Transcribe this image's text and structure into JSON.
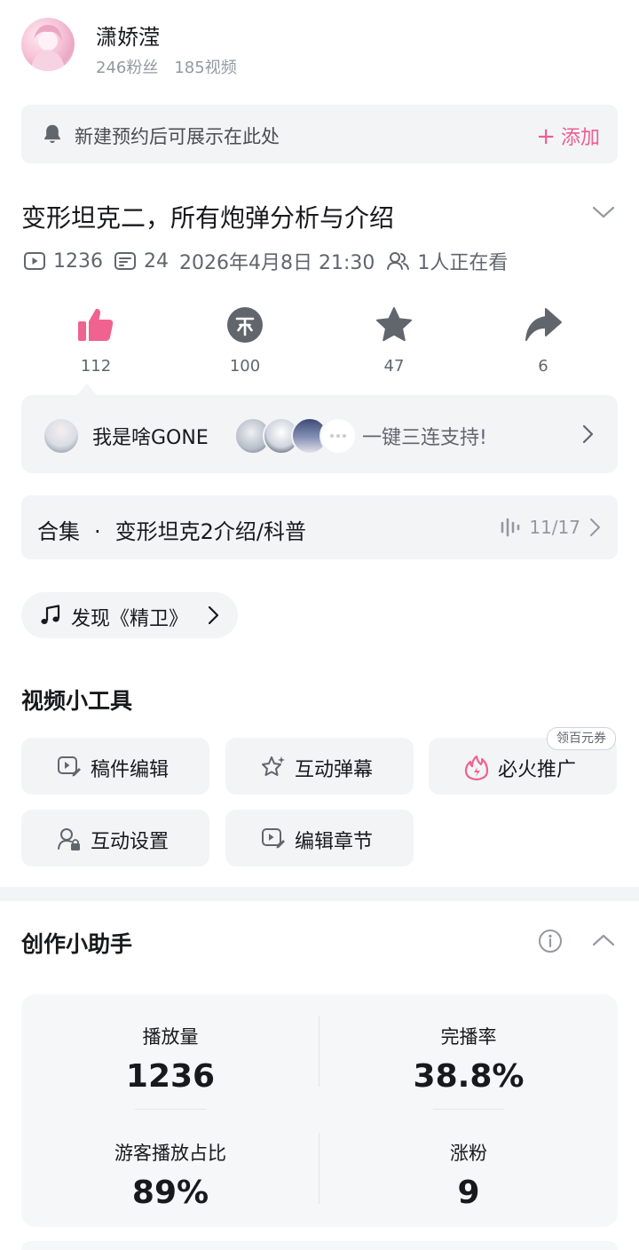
{
  "user": {
    "name": "潇娇滢",
    "fans": "246粉丝",
    "videos": "185视频"
  },
  "reserve": {
    "icon": "bell-icon",
    "text": "新建预约后可展示在此处",
    "add_label": "添加",
    "accent": "#ee5d8f"
  },
  "video": {
    "title": "变形坦克二，所有炮弹分析与介绍",
    "plays": "1236",
    "danmaku": "24",
    "datetime": "2026年4月8日 21:30",
    "watching": "1人正在看"
  },
  "actions": [
    {
      "name": "like",
      "icon": "thumbs-up-icon",
      "count": "112",
      "color": "#f0628f"
    },
    {
      "name": "coin",
      "icon": "coin-icon",
      "count": "100",
      "color": "#61666d"
    },
    {
      "name": "favorite",
      "icon": "star-icon",
      "count": "47",
      "color": "#61666d"
    },
    {
      "name": "share",
      "icon": "share-icon",
      "count": "6",
      "color": "#61666d"
    }
  ],
  "triple": {
    "username": "我是啥GONE",
    "text": "一键三连支持!"
  },
  "collection": {
    "label": "合集",
    "separator": "·",
    "name": "变形坦克2介绍/科普",
    "progress": "11/17"
  },
  "music": {
    "text": "发现《精卫》"
  },
  "tools": {
    "title": "视频小工具",
    "badge": "领百元券",
    "items": [
      {
        "label": "稿件编辑",
        "icon": "video-edit-icon"
      },
      {
        "label": "互动弹幕",
        "icon": "star-sparkle-icon"
      },
      {
        "label": "必火推广",
        "icon": "fire-icon"
      },
      {
        "label": "互动设置",
        "icon": "user-lock-icon"
      },
      {
        "label": "编辑章节",
        "icon": "chapter-edit-icon"
      }
    ]
  },
  "assistant": {
    "title": "创作小助手",
    "stats": [
      {
        "label": "播放量",
        "value": "1236"
      },
      {
        "label": "完播率",
        "value": "38.8%"
      },
      {
        "label": "游客播放占比",
        "value": "89%"
      },
      {
        "label": "涨粉",
        "value": "9"
      }
    ]
  }
}
